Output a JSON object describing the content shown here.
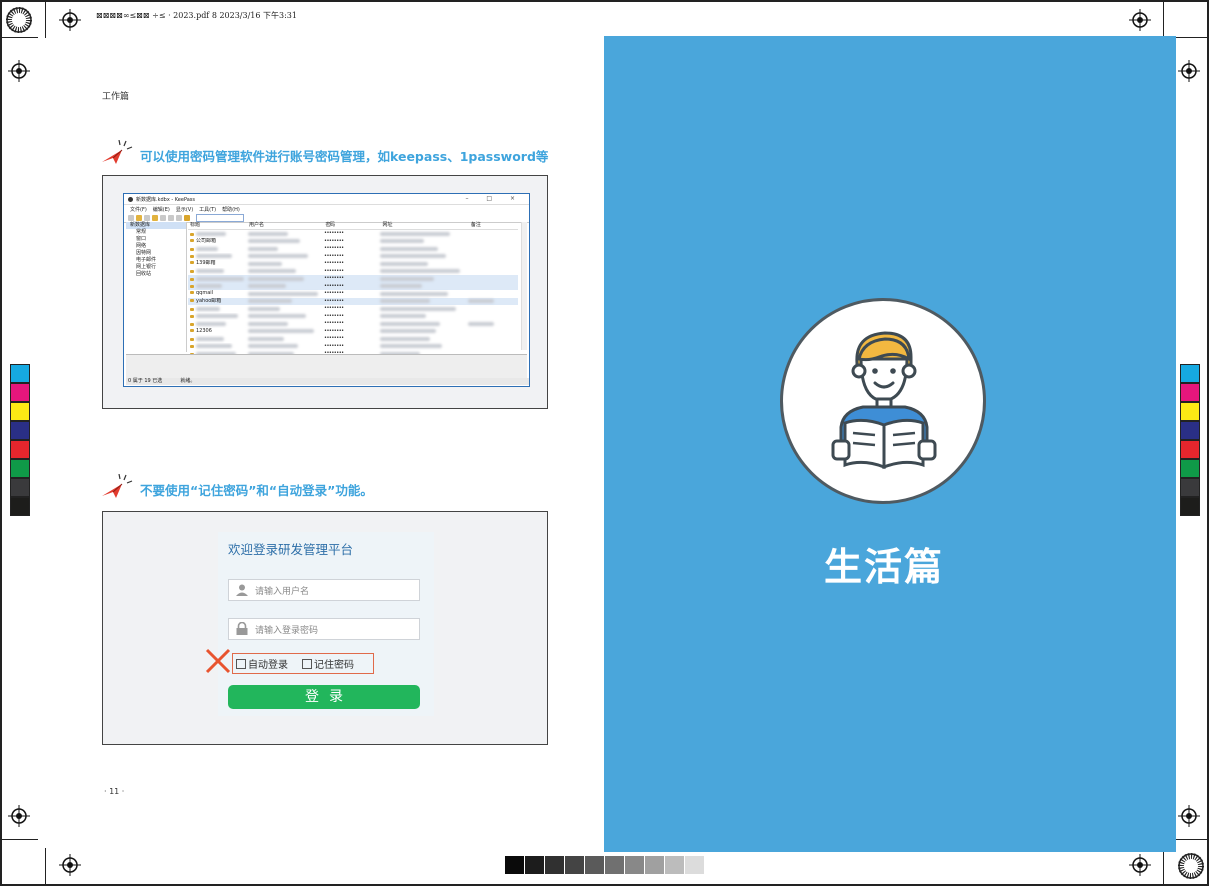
{
  "print_info": "⊠⊠⊠⊠∞≤⊠⊠ ÷≤ · 2023.pdf  8   2023/3/16   下午3:31",
  "section_label": "工作篇",
  "tips": [
    {
      "text": "可以使用密码管理软件进行账号密码管理，如keepass、1password等"
    },
    {
      "text": "不要使用“记住密码”和“自动登录”功能。"
    }
  ],
  "keepass": {
    "window_title": "新数据库.kdbx - KeePass",
    "window_controls": "– □ ×",
    "menu": [
      "文件(F)",
      "编辑(E)",
      "显示(V)",
      "工具(T)",
      "帮助(H)"
    ],
    "tree": [
      "新数据库",
      "常规",
      "窗口",
      "网络",
      "因特网",
      "电子邮件",
      "网上银行",
      "回收站"
    ],
    "columns": [
      "标题",
      "用户名",
      "密码",
      "网址",
      "备注"
    ],
    "rows": [
      "",
      "公司邮箱",
      "",
      "",
      "139邮箱",
      "",
      "",
      "",
      "qqmail",
      "yahoo邮箱",
      "",
      "",
      "",
      "12306",
      "",
      "",
      ""
    ],
    "password_mask": "••••••••",
    "status_left": "0 属于 19 已选",
    "status_right": "就绪。"
  },
  "login": {
    "title": "欢迎登录研发管理平台",
    "username_placeholder": "请输入用户名",
    "password_placeholder": "请输入登录密码",
    "auto_login": "自动登录",
    "remember_password": "记住密码",
    "submit": "登录"
  },
  "page_number": "· 11 ·",
  "right_page": {
    "title": "生活篇",
    "bg_color": "#4aa6db"
  },
  "colors": {
    "accent": "#3ea4dd",
    "login_button": "#22b65c",
    "cross": "#e8542f"
  }
}
